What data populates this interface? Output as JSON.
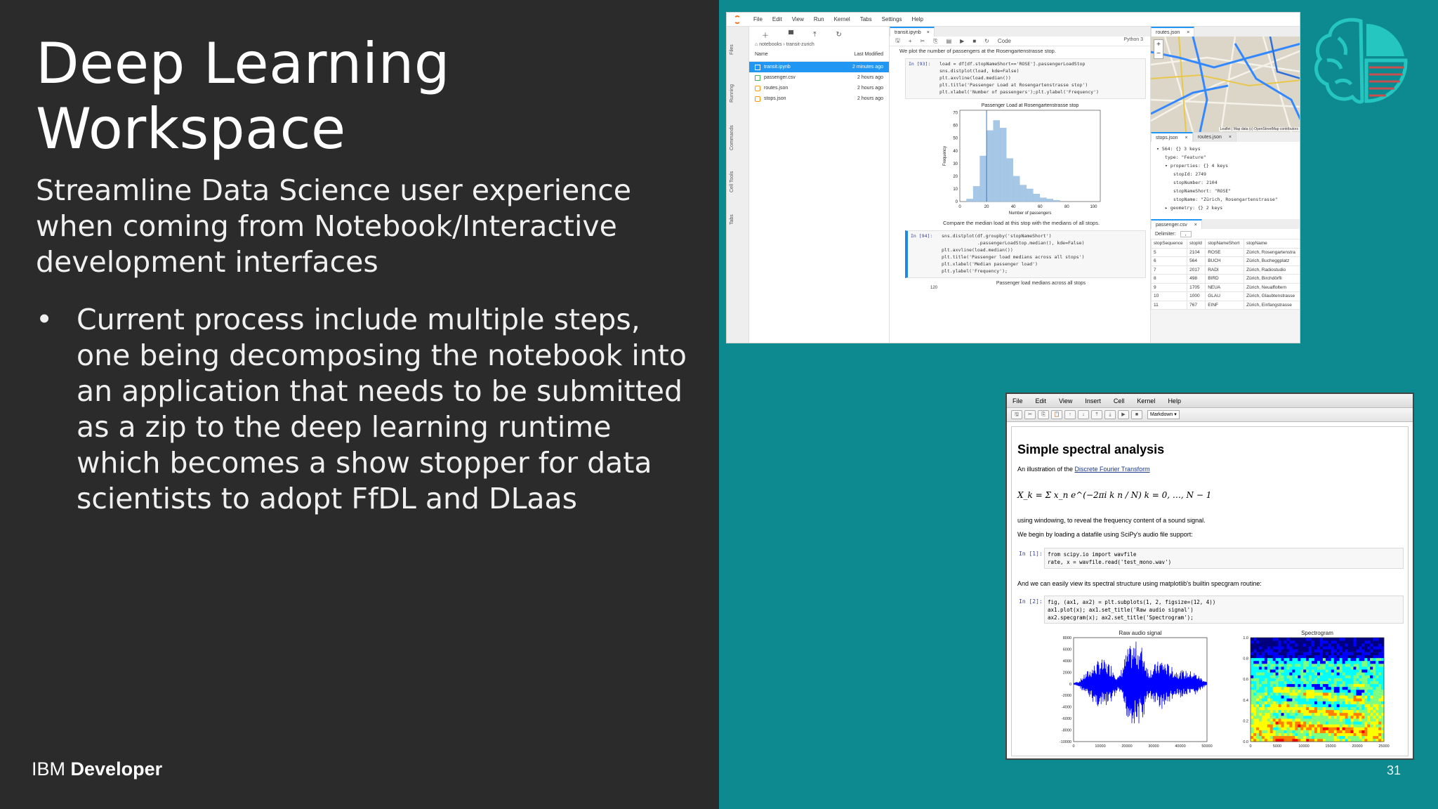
{
  "slide": {
    "title": "Deep Learning Workspace",
    "lead": "Streamline Data Science user experience when coming from Notebook/Interactive development interfaces",
    "bullets": [
      "Current process include multiple steps, one being decomposing the notebook into an application that needs to be submitted as a zip to the deep learning runtime which becomes a show stopper for data scientists to adopt FfDL and DLaas"
    ],
    "bullet_glyph": "•",
    "footer_brand_regular": "IBM",
    "footer_brand_bold": "Developer",
    "page_number": "31",
    "colors": {
      "left_panel": "#2b2b2b",
      "right_panel": "#0d8a8f",
      "logo": "#26c6c0",
      "logo_stripe": "#c94f4f"
    },
    "logo_icon": "brain-pie-chart-icon"
  },
  "jupyterlab": {
    "menu": [
      "File",
      "Edit",
      "View",
      "Run",
      "Kernel",
      "Tabs",
      "Settings",
      "Help"
    ],
    "sidebar_tabs": [
      "Files",
      "Running",
      "Commands",
      "Cell Tools",
      "Tabs"
    ],
    "breadcrumb": "notebooks › transit-zurich",
    "file_header": {
      "name": "Name",
      "modified": "Last Modified"
    },
    "files": [
      {
        "name": "transit.ipynb",
        "modified": "2 minutes ago"
      },
      {
        "name": "passenger.csv",
        "modified": "2 hours ago"
      },
      {
        "name": "routes.json",
        "modified": "2 hours ago"
      },
      {
        "name": "stops.json",
        "modified": "2 hours ago"
      }
    ],
    "notebook_tab": "transit.ipynb",
    "cell_type": "Code",
    "kernel": "Python 3",
    "md1": "We plot the number of passengers at the Rosengartenstrasse stop.",
    "cell1_prompt": "In [93]:",
    "cell1_lines": [
      "load = df[df.stopNameShort=='ROSE'].passengerLoadStop",
      "sns.distplot(load, kde=False)",
      "plt.axvline(load.median())",
      "plt.title('Passenger Load at Rosengartenstrasse stop')",
      "plt.xlabel('Number of passengers');plt.ylabel('Frequency')"
    ],
    "md2": "Compare the median load at this stop with the medians of all stops.",
    "cell2_prompt": "In [94]:",
    "cell2_lines": [
      "sns.distplot(df.groupby('stopNameShort')",
      "             .passengerLoadStop.median(), kde=False)",
      "plt.axvline(load.median())",
      "plt.title('Passenger load medians across all stops')",
      "plt.xlabel('Median passenger load')",
      "plt.ylabel('Frequency');"
    ],
    "chart2_title": "Passenger load medians across all stops",
    "chart2_first_tick": "120",
    "routes_tab": "routes.json",
    "map_attribution": "Leaflet | Map data (c) OpenStreetMap contributors",
    "map_zoom_in": "+",
    "map_zoom_out": "−",
    "stops_tab": "stops.json",
    "routes_tab2": "routes.json",
    "json_lines": [
      {
        "indent": 0,
        "text": "▾ 564: {} 3 keys"
      },
      {
        "indent": 1,
        "text": "type: \"Feature\""
      },
      {
        "indent": 1,
        "text": "▾ properties: {} 4 keys"
      },
      {
        "indent": 2,
        "text": "stopId: 2749"
      },
      {
        "indent": 2,
        "text": "stopNumber: 2104"
      },
      {
        "indent": 2,
        "text": "stopNameShort: \"ROSE\""
      },
      {
        "indent": 2,
        "text": "stopName: \"Zürich, Rosengartenstrasse\""
      },
      {
        "indent": 1,
        "text": "▸ geometry: {} 2 keys"
      }
    ],
    "csv_tab": "passenger.csv",
    "csv_delimiter_label": "Delimiter:",
    "csv_delimiter_value": ",",
    "csv_headers": [
      "stopSequence",
      "stopId",
      "stopNameShort",
      "stopName"
    ],
    "csv_rows": [
      [
        "5",
        "2104",
        "ROSE",
        "Zürich, Rosengartenstra"
      ],
      [
        "6",
        "564",
        "BUCH",
        "Zürich, Bucheggplatz"
      ],
      [
        "7",
        "2017",
        "RADI",
        "Zürich, Radiostudio"
      ],
      [
        "8",
        "498",
        "BIRD",
        "Zürich, Birchdörfli"
      ],
      [
        "9",
        "1705",
        "NEUA",
        "Zürich, Neuaffoltern"
      ],
      [
        "10",
        "1000",
        "GLAU",
        "Zürich, Glaubtenstrasse"
      ],
      [
        "11",
        "767",
        "EINF",
        "Zürich, Einfangstrasse"
      ]
    ]
  },
  "classic_notebook": {
    "menu": [
      "File",
      "Edit",
      "View",
      "Insert",
      "Cell",
      "Kernel",
      "Help"
    ],
    "toolbar_buttons": [
      "save-icon",
      "cut-icon",
      "copy-icon",
      "paste-icon",
      "move-up-icon",
      "move-down-icon",
      "insert-above-icon",
      "insert-below-icon",
      "run-icon",
      "stop-icon"
    ],
    "toolbar_glyphs": [
      "🖫",
      "✂",
      "⎘",
      "📋",
      "↑",
      "↓",
      "⤒",
      "⤓",
      "▶",
      "■"
    ],
    "cell_type": "Markdown ▾",
    "heading": "Simple spectral analysis",
    "intro_prefix": "An illustration of the ",
    "intro_link": "Discrete Fourier Transform",
    "formula": "X_k = Σ x_n e^(−2πi k n / N)    k = 0, …, N − 1",
    "p2": "using windowing, to reveal the frequency content of a sound signal.",
    "p3": "We begin by loading a datafile using SciPy's audio file support:",
    "in1_prompt": "In [1]:",
    "in1_lines": [
      "from scipy.io import wavfile",
      "rate, x = wavfile.read('test_mono.wav')"
    ],
    "p4": "And we can easily view its spectral structure using matplotlib's builtin specgram routine:",
    "in2_prompt": "In [2]:",
    "in2_lines": [
      "fig, (ax1, ax2) = plt.subplots(1, 2, figsize=(12, 4))",
      "ax1.plot(x); ax1.set_title('Raw audio signal')",
      "ax2.specgram(x); ax2.set_title('Spectrogram');"
    ]
  },
  "chart_data": [
    {
      "type": "bar",
      "title": "Passenger Load at Rosengartenstrasse stop",
      "xlabel": "Number of passengers",
      "ylabel": "Frequency",
      "bin_edges": [
        5,
        10,
        15,
        20,
        25,
        30,
        35,
        40,
        45,
        50,
        55,
        60,
        65,
        70,
        75
      ],
      "values": [
        2,
        12,
        36,
        56,
        64,
        58,
        34,
        20,
        13,
        10,
        6,
        3,
        2,
        1
      ],
      "median_line": 20,
      "xlim": [
        0,
        105
      ],
      "ylim": [
        0,
        72
      ],
      "xticks": [
        0,
        20,
        40,
        60,
        80,
        100
      ],
      "yticks": [
        0,
        10,
        20,
        30,
        40,
        50,
        60,
        70
      ]
    },
    {
      "type": "line",
      "title": "Raw audio signal",
      "xlabel": "",
      "ylabel": "",
      "xlim": [
        0,
        50000
      ],
      "ylim": [
        -10000,
        8000
      ],
      "xticks": [
        0,
        10000,
        20000,
        30000,
        40000,
        50000
      ],
      "yticks": [
        8000,
        6000,
        4000,
        2000,
        0,
        -2000,
        -4000,
        -6000,
        -8000,
        -10000
      ],
      "envelope": [
        {
          "x": 0,
          "amp": 200
        },
        {
          "x": 2000,
          "amp": 500
        },
        {
          "x": 5000,
          "amp": 2200
        },
        {
          "x": 10000,
          "amp": 4500
        },
        {
          "x": 14000,
          "amp": 3500
        },
        {
          "x": 17000,
          "amp": 1200
        },
        {
          "x": 20000,
          "amp": 6000
        },
        {
          "x": 23000,
          "amp": 7500
        },
        {
          "x": 26000,
          "amp": 6500
        },
        {
          "x": 28000,
          "amp": 2500
        },
        {
          "x": 33000,
          "amp": 4500
        },
        {
          "x": 38000,
          "amp": 2500
        },
        {
          "x": 45000,
          "amp": 2200
        },
        {
          "x": 50000,
          "amp": 300
        }
      ]
    },
    {
      "type": "heatmap",
      "title": "Spectrogram",
      "xlabel": "",
      "ylabel": "",
      "xlim": [
        0,
        25000
      ],
      "ylim": [
        0,
        1.0
      ],
      "xticks": [
        0,
        5000,
        10000,
        15000,
        20000,
        25000
      ],
      "yticks": [
        0.0,
        0.2,
        0.4,
        0.6,
        0.8,
        1.0
      ],
      "colormap": [
        "#00007f",
        "#0000ff",
        "#00ffff",
        "#7fff7f",
        "#ffff00",
        "#ff7f00",
        "#ff0000"
      ]
    }
  ]
}
